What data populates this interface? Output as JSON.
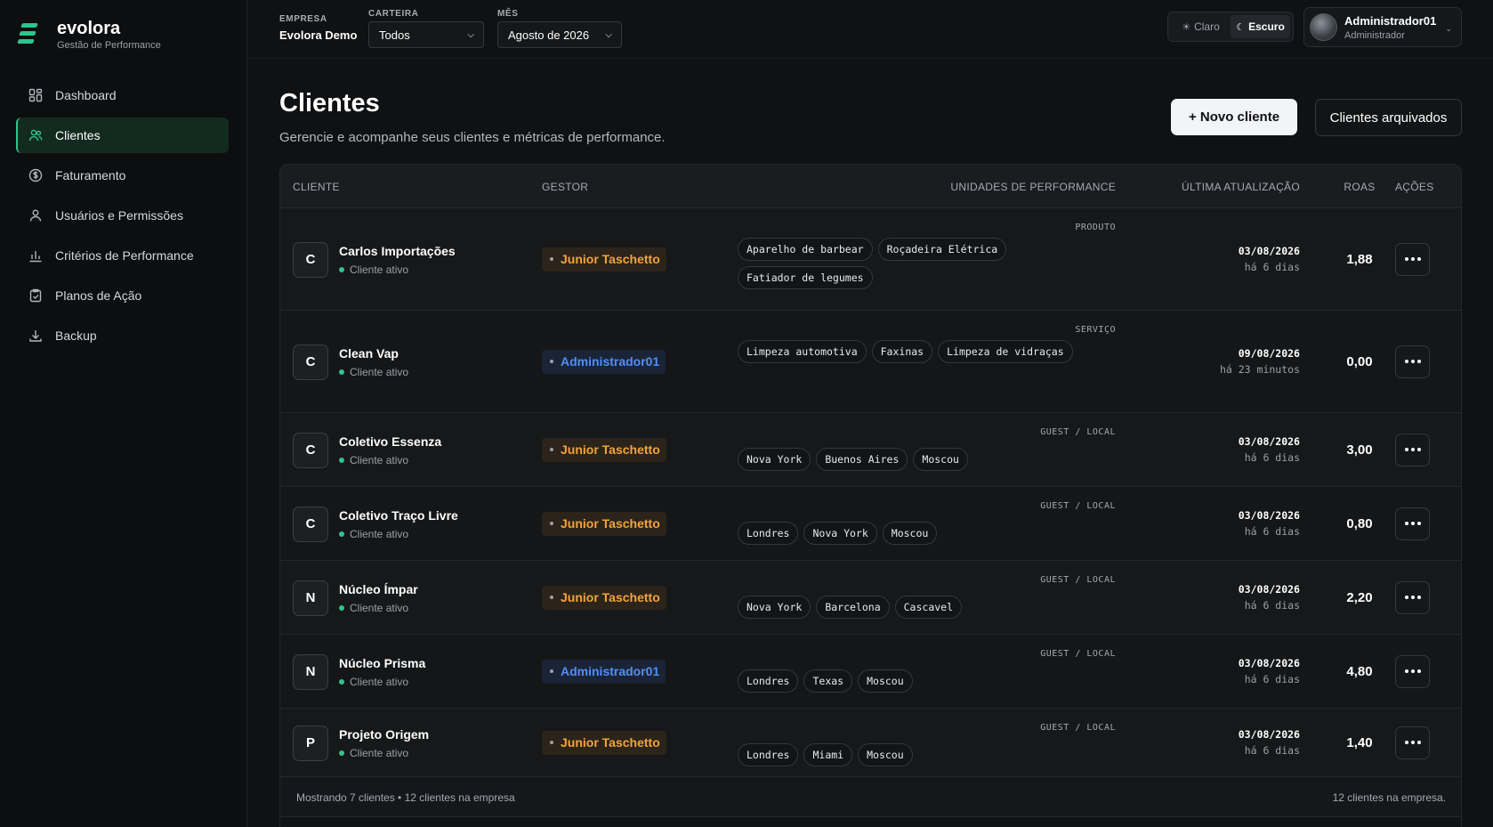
{
  "brand": {
    "name": "evolora",
    "subtitle": "Gestão de Performance"
  },
  "sidebar": {
    "items": [
      {
        "label": "Dashboard",
        "icon": "dashboard-icon",
        "active": false
      },
      {
        "label": "Clientes",
        "icon": "users-icon",
        "active": true
      },
      {
        "label": "Faturamento",
        "icon": "dollar-icon",
        "active": false
      },
      {
        "label": "Usuários e Permissões",
        "icon": "user-icon",
        "active": false
      },
      {
        "label": "Critérios de Performance",
        "icon": "bar-chart-icon",
        "active": false
      },
      {
        "label": "Planos de Ação",
        "icon": "clipboard-check-icon",
        "active": false
      },
      {
        "label": "Backup",
        "icon": "download-icon",
        "active": false
      }
    ]
  },
  "topbar": {
    "empresa_label": "EMPRESA",
    "empresa_value": "Evolora Demo",
    "carteira_label": "CARTEIRA",
    "carteira_value": "Todos",
    "mes_label": "MÊS",
    "mes_value": "Agosto de 2026",
    "theme_light": "Claro",
    "theme_dark": "Escuro",
    "user_name": "Administrador01",
    "user_role": "Administrador"
  },
  "header": {
    "title": "Clientes",
    "subtitle": "Gerencie e acompanhe seus clientes e métricas de performance.",
    "new_button": "+ Novo cliente",
    "archived_button": "Clientes arquivados"
  },
  "table": {
    "columns": {
      "cliente": "CLIENTE",
      "gestor": "GESTOR",
      "unidades": "UNIDADES DE PERFORMANCE",
      "atualizacao": "ÚLTIMA ATUALIZAÇÃO",
      "roas": "ROAS",
      "acoes": "AÇÕES"
    },
    "rows": [
      {
        "initial": "C",
        "name": "Carlos Importações",
        "status": "Cliente ativo",
        "gestor": "Junior Taschetto",
        "gestor_color": "orange",
        "unit_type": "PRODUTO",
        "units": [
          "Aparelho de barbear",
          "Roçadeira Elétrica",
          "Fatiador de legumes"
        ],
        "date": "03/08/2026",
        "ago": "há 6 dias",
        "roas": "1,88"
      },
      {
        "initial": "C",
        "name": "Clean Vap",
        "status": "Cliente ativo",
        "gestor": "Administrador01",
        "gestor_color": "blue",
        "unit_type": "SERVIÇO",
        "units": [
          "Limpeza automotiva",
          "Faxinas",
          "Limpeza de vidraças"
        ],
        "date": "09/08/2026",
        "ago": "há 23 minutos",
        "roas": "0,00"
      },
      {
        "initial": "C",
        "name": "Coletivo Essenza",
        "status": "Cliente ativo",
        "gestor": "Junior Taschetto",
        "gestor_color": "orange",
        "unit_type": "GUEST / LOCAL",
        "units": [
          "Nova York",
          "Buenos Aires",
          "Moscou"
        ],
        "date": "03/08/2026",
        "ago": "há 6 dias",
        "roas": "3,00"
      },
      {
        "initial": "C",
        "name": "Coletivo Traço Livre",
        "status": "Cliente ativo",
        "gestor": "Junior Taschetto",
        "gestor_color": "orange",
        "unit_type": "GUEST / LOCAL",
        "units": [
          "Londres",
          "Nova York",
          "Moscou"
        ],
        "date": "03/08/2026",
        "ago": "há 6 dias",
        "roas": "0,80"
      },
      {
        "initial": "N",
        "name": "Núcleo Ímpar",
        "status": "Cliente ativo",
        "gestor": "Junior Taschetto",
        "gestor_color": "orange",
        "unit_type": "GUEST / LOCAL",
        "units": [
          "Nova York",
          "Barcelona",
          "Cascavel"
        ],
        "date": "03/08/2026",
        "ago": "há 6 dias",
        "roas": "2,20"
      },
      {
        "initial": "N",
        "name": "Núcleo Prisma",
        "status": "Cliente ativo",
        "gestor": "Administrador01",
        "gestor_color": "blue",
        "unit_type": "GUEST / LOCAL",
        "units": [
          "Londres",
          "Texas",
          "Moscou"
        ],
        "date": "03/08/2026",
        "ago": "há 6 dias",
        "roas": "4,80"
      },
      {
        "initial": "P",
        "name": "Projeto Origem",
        "status": "Cliente ativo",
        "gestor": "Junior Taschetto",
        "gestor_color": "orange",
        "unit_type": "GUEST / LOCAL",
        "units": [
          "Londres",
          "Miami",
          "Moscou"
        ],
        "date": "03/08/2026",
        "ago": "há 6 dias",
        "roas": "1,40"
      }
    ],
    "footer_left": "Mostrando 7 clientes • 12 clientes na empresa",
    "footer_right": "12 clientes na empresa."
  },
  "colors": {
    "accent": "#2fc48c",
    "gestor_orange": "#f1a43c",
    "gestor_blue": "#4f8ff7"
  }
}
